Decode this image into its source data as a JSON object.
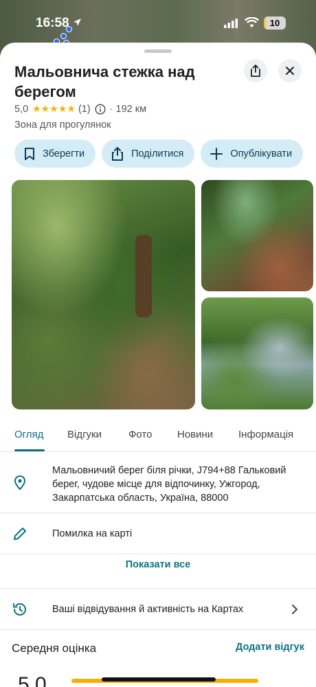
{
  "status_bar": {
    "time": "16:58",
    "battery": "10",
    "battery_level": 0.1
  },
  "place": {
    "title": "Мальовнича стежка над берегом",
    "rating": "5,0",
    "stars": "★★★★★",
    "review_count": "(1)",
    "distance": "· 192 км",
    "category": "Зона для прогулянок"
  },
  "actions": [
    {
      "label": "Зберегти",
      "icon": "bookmark-icon"
    },
    {
      "label": "Поділитися",
      "icon": "share-icon"
    },
    {
      "label": "Опублікувати",
      "icon": "plus-icon"
    }
  ],
  "tabs": [
    {
      "label": "Огляд",
      "active": true
    },
    {
      "label": "Відгуки"
    },
    {
      "label": "Фото"
    },
    {
      "label": "Новини"
    },
    {
      "label": "Інформація"
    }
  ],
  "details": {
    "address": "Мальовничий берег біля річки, J794+88 Гальковий берег, чудове місце для відпочинку, Ужгород, Закарпатська область, Україна, 88000",
    "report": "Помилка на карті",
    "show_all": "Показати все",
    "activity": "Ваші відвідування й активність на Картах"
  },
  "rating_section": {
    "title": "Середня оцінка",
    "add_review": "Додати відгук",
    "score": "5,0"
  },
  "colors": {
    "accent": "#0b7285",
    "chip_bg": "#d3ecf6",
    "star": "#f6b100"
  }
}
